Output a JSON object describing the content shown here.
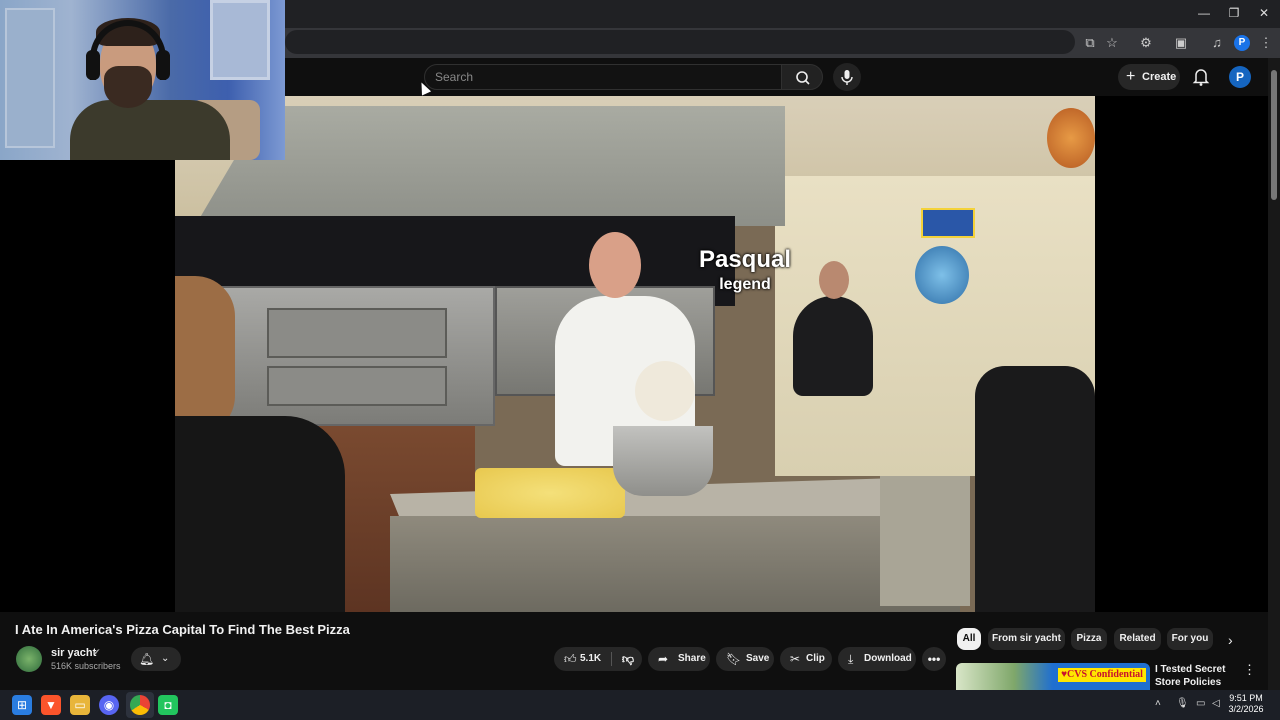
{
  "browser": {
    "window_controls": [
      "—",
      "❐",
      "✕"
    ],
    "toolbar_icons": [
      "cast-icon",
      "star-icon",
      "extensions-icon",
      "sidebar-icon",
      "media-icon",
      "profile-icon",
      "menu-icon"
    ],
    "profile_letter": "P"
  },
  "masthead": {
    "search_placeholder": "Search",
    "create_label": "Create",
    "avatar_letter": "P"
  },
  "video": {
    "caption_name": "Pasqual",
    "caption_sub": "legend"
  },
  "watch": {
    "title": "I Ate In America's Pizza Capital To Find The Best Pizza",
    "channel_name": "sir yacht",
    "subscribers": "516K subscribers",
    "likes": "5.1K",
    "share_label": "Share",
    "save_label": "Save",
    "clip_label": "Clip",
    "download_label": "Download"
  },
  "chips": [
    "All",
    "From sir yacht",
    "Pizza",
    "Related",
    "For you"
  ],
  "recommendation": {
    "badge": "♥CVS Confidential",
    "title": "I Tested Secret Store Policies"
  },
  "taskbar": {
    "time": "9:51 PM",
    "date": "3/2/2026"
  },
  "colors": {
    "accent": "#1565c0",
    "background": "#0f0f0f",
    "chip_bg": "#272727"
  }
}
